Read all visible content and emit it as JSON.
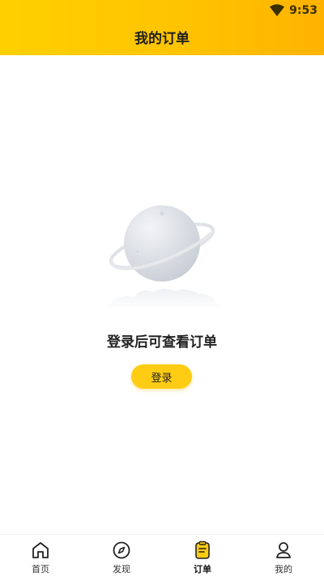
{
  "status_bar": {
    "time": "9:53"
  },
  "header": {
    "title": "我的订单"
  },
  "empty_state": {
    "message": "登录后可查看订单",
    "login_button": "登录"
  },
  "tabbar": {
    "items": [
      {
        "label": "首页",
        "icon": "home-icon"
      },
      {
        "label": "发现",
        "icon": "compass-icon"
      },
      {
        "label": "订单",
        "icon": "order-icon",
        "active": true
      },
      {
        "label": "我的",
        "icon": "user-icon"
      }
    ]
  },
  "colors": {
    "accent": "#ffcc14",
    "header_start": "#ffd000",
    "header_end": "#ffb300"
  }
}
